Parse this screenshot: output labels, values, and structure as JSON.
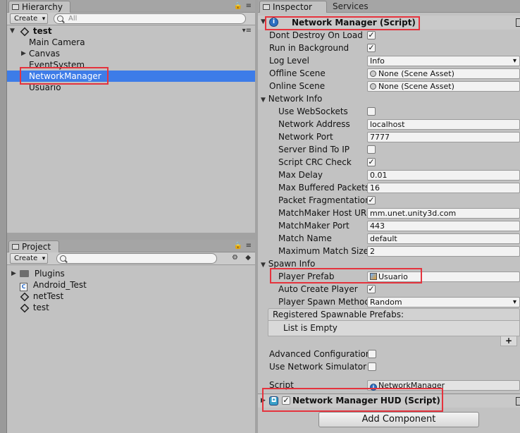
{
  "hierarchy": {
    "tab_label": "Hierarchy",
    "create_label": "Create",
    "search_placeholder": "All",
    "scene_name": "test",
    "items": [
      {
        "label": "Main Camera"
      },
      {
        "label": "Canvas"
      },
      {
        "label": "EventSystem"
      },
      {
        "label": "NetworkManager"
      },
      {
        "label": "Usuario"
      }
    ]
  },
  "project": {
    "tab_label": "Project",
    "create_label": "Create",
    "search_placeholder": "",
    "items": [
      {
        "label": "Plugins",
        "icon": "folder-icon"
      },
      {
        "label": "Android_Test",
        "icon": "csharp-script-icon"
      },
      {
        "label": "netTest",
        "icon": "unity-scene-icon"
      },
      {
        "label": "test",
        "icon": "unity-scene-icon"
      }
    ]
  },
  "inspector": {
    "tabs": [
      "Inspector",
      "Services"
    ],
    "component_title": "Network Manager (Script)",
    "fields": {
      "dont_destroy_label": "Dont Destroy On Load",
      "run_in_background_label": "Run in Background",
      "log_level_label": "Log Level",
      "log_level_value": "Info",
      "offline_scene_label": "Offline Scene",
      "offline_scene_value": "None (Scene Asset)",
      "online_scene_label": "Online Scene",
      "online_scene_value": "None (Scene Asset)",
      "network_info_label": "Network Info",
      "use_websockets_label": "Use WebSockets",
      "network_address_label": "Network Address",
      "network_address_value": "localhost",
      "network_port_label": "Network Port",
      "network_port_value": "7777",
      "server_bind_label": "Server Bind To IP",
      "script_crc_label": "Script CRC Check",
      "max_delay_label": "Max Delay",
      "max_delay_value": "0.01",
      "max_buffered_label": "Max Buffered Packets",
      "max_buffered_value": "16",
      "packet_frag_label": "Packet Fragmentation",
      "matchmaker_host_label": "MatchMaker Host URI",
      "matchmaker_host_value": "mm.unet.unity3d.com",
      "matchmaker_port_label": "MatchMaker Port",
      "matchmaker_port_value": "443",
      "match_name_label": "Match Name",
      "match_name_value": "default",
      "max_match_size_label": "Maximum Match Size",
      "max_match_size_value": "2",
      "spawn_info_label": "Spawn Info",
      "player_prefab_label": "Player Prefab",
      "player_prefab_value": "Usuario",
      "auto_create_label": "Auto Create Player",
      "player_spawn_label": "Player Spawn Method",
      "player_spawn_value": "Random",
      "registered_prefabs_label": "Registered Spawnable Prefabs:",
      "list_empty_label": "List is Empty",
      "add_symbol": "+",
      "advanced_config_label": "Advanced Configuration",
      "use_simulator_label": "Use Network Simulator",
      "script_label": "Script",
      "script_value": "NetworkManager"
    },
    "hud_title": "Network Manager HUD (Script)",
    "add_component_label": "Add Component",
    "checkmark": "✓"
  }
}
